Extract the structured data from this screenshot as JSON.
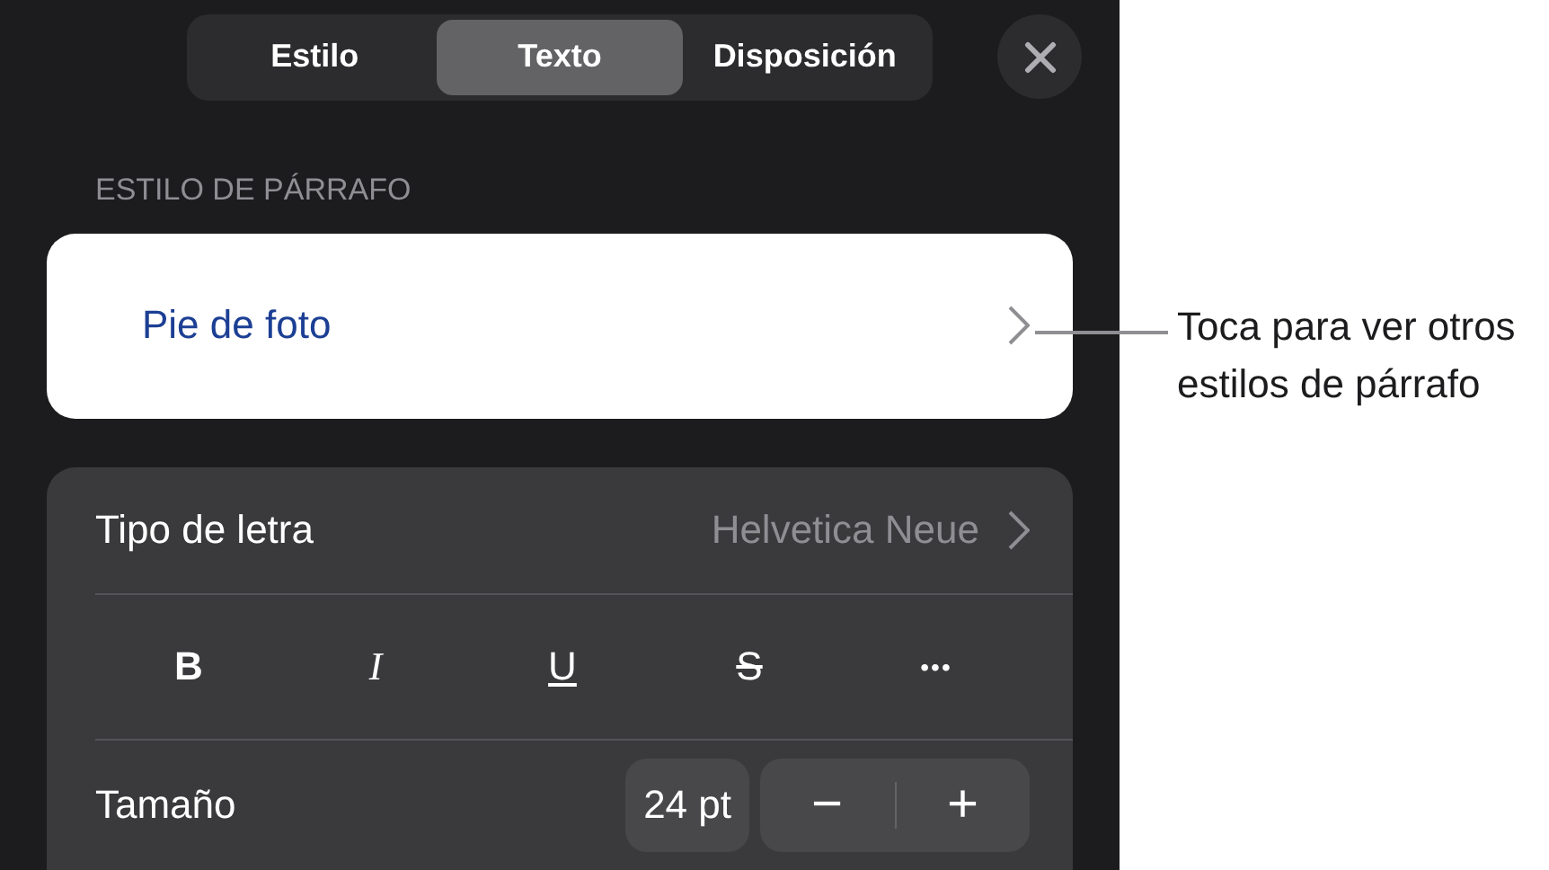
{
  "tabs": [
    {
      "label": "Estilo",
      "selected": false
    },
    {
      "label": "Texto",
      "selected": true
    },
    {
      "label": "Disposición",
      "selected": false
    }
  ],
  "section_label": "ESTILO DE PÁRRAFO",
  "paragraph_style": {
    "value": "Pie de foto"
  },
  "font_row": {
    "label": "Tipo de letra",
    "value": "Helvetica Neue"
  },
  "format_buttons": [
    {
      "label": "B",
      "kind": "bold"
    },
    {
      "label": "I",
      "kind": "italic"
    },
    {
      "label": "U",
      "kind": "underline"
    },
    {
      "label": "S",
      "kind": "strike"
    },
    {
      "label": "•••",
      "kind": "more"
    }
  ],
  "size_row": {
    "label": "Tamaño",
    "value": "24 pt",
    "decrease": "−",
    "increase": "+"
  },
  "callout": "Toca para ver otros estilos de párrafo"
}
